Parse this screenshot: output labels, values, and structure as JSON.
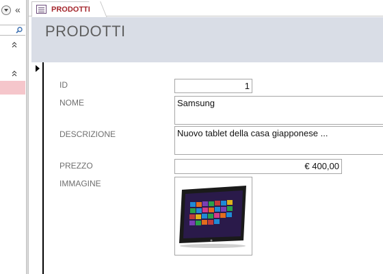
{
  "nav": {
    "collapse_glyph": "«",
    "chevron_glyph": "⌃"
  },
  "tab": {
    "label": "PRODOTTI",
    "icon": "form-icon"
  },
  "form": {
    "title": "PRODOTTI"
  },
  "fields": {
    "id": {
      "label": "ID",
      "value": "1"
    },
    "nome": {
      "label": "NOME",
      "value": "Samsung"
    },
    "descrizione": {
      "label": "DESCRIZIONE",
      "value": "Nuovo tablet della casa giapponese ..."
    },
    "prezzo": {
      "label": "PREZZO",
      "value": "€ 400,00"
    },
    "immagine": {
      "label": "IMMAGINE",
      "image": "tablet-image"
    }
  },
  "colors": {
    "tab_label": "#a4262c",
    "header_band": "#d9dde6",
    "nav_selection": "#f5c6cb"
  }
}
